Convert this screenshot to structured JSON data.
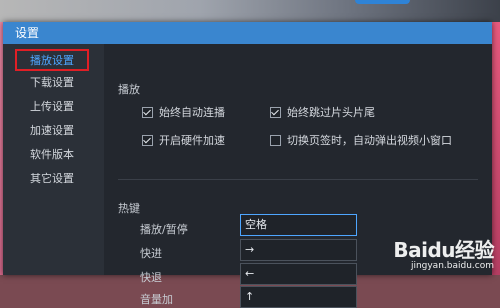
{
  "window": {
    "title": "设置"
  },
  "sidebar": {
    "items": [
      {
        "label": "播放设置",
        "active": true
      },
      {
        "label": "下载设置"
      },
      {
        "label": "上传设置"
      },
      {
        "label": "加速设置"
      },
      {
        "label": "软件版本"
      },
      {
        "label": "其它设置"
      }
    ]
  },
  "playback": {
    "section_title": "播放",
    "options": [
      {
        "label": "始终自动连播",
        "checked": true
      },
      {
        "label": "始终跳过片头片尾",
        "checked": true
      },
      {
        "label": "开启硬件加速",
        "checked": true
      },
      {
        "label": "切换页签时，自动弹出视频小窗口",
        "checked": false
      }
    ]
  },
  "hotkeys": {
    "section_title": "热键",
    "rows": [
      {
        "label": "播放/暂停",
        "value": "空格"
      },
      {
        "label": "快进",
        "value": "→"
      },
      {
        "label": "快退",
        "value": "←"
      },
      {
        "label": "音量加",
        "value": "↑"
      }
    ]
  },
  "watermark": {
    "logo": "Baidu经验",
    "url": "jingyan.baidu.com"
  },
  "colors": {
    "accent": "#3a86cf",
    "highlight_border": "#e01f26",
    "active_text": "#4ea6ff"
  }
}
